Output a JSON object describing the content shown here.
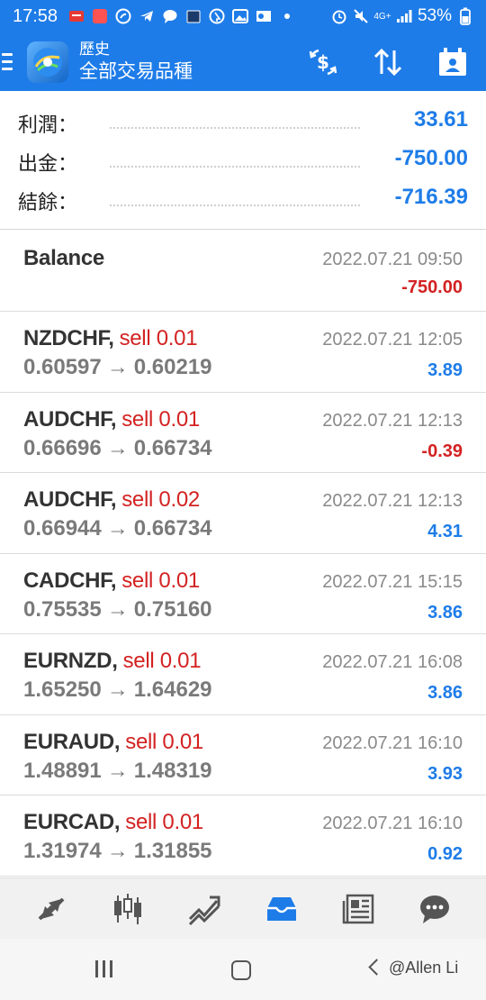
{
  "status_bar": {
    "time": "17:58",
    "network": "4G+",
    "battery": "53%"
  },
  "app_bar": {
    "subtitle": "歷史",
    "title": "全部交易品種",
    "icons": [
      "menu-icon",
      "app-logo-icon",
      "currency-filter-icon",
      "sort-icon",
      "calendar-icon"
    ]
  },
  "summary": {
    "rows": [
      {
        "label": "利潤：",
        "value": "33.61"
      },
      {
        "label": "出金：",
        "value": "-750.00"
      },
      {
        "label": "結餘：",
        "value": "-716.39"
      }
    ]
  },
  "balance_entry": {
    "label": "Balance",
    "datetime": "2022.07.21 09:50",
    "amount": "-750.00"
  },
  "trades": [
    {
      "symbol": "NZDCHF,",
      "side": "sell 0.01",
      "open": "0.60597",
      "close": "0.60219",
      "arrow": "→",
      "datetime": "2022.07.21 12:05",
      "profit": "3.89",
      "sign": "pos"
    },
    {
      "symbol": "AUDCHF,",
      "side": "sell 0.01",
      "open": "0.66696",
      "close": "0.66734",
      "arrow": "→",
      "datetime": "2022.07.21 12:13",
      "profit": "-0.39",
      "sign": "neg"
    },
    {
      "symbol": "AUDCHF,",
      "side": "sell 0.02",
      "open": "0.66944",
      "close": "0.66734",
      "arrow": "→",
      "datetime": "2022.07.21 12:13",
      "profit": "4.31",
      "sign": "pos"
    },
    {
      "symbol": "CADCHF,",
      "side": "sell 0.01",
      "open": "0.75535",
      "close": "0.75160",
      "arrow": "→",
      "datetime": "2022.07.21 15:15",
      "profit": "3.86",
      "sign": "pos"
    },
    {
      "symbol": "EURNZD,",
      "side": "sell 0.01",
      "open": "1.65250",
      "close": "1.64629",
      "arrow": "→",
      "datetime": "2022.07.21 16:08",
      "profit": "3.86",
      "sign": "pos"
    },
    {
      "symbol": "EURAUD,",
      "side": "sell 0.01",
      "open": "1.48891",
      "close": "1.48319",
      "arrow": "→",
      "datetime": "2022.07.21 16:10",
      "profit": "3.93",
      "sign": "pos"
    },
    {
      "symbol": "EURCAD,",
      "side": "sell 0.01",
      "open": "1.31974",
      "close": "1.31855",
      "arrow": "→",
      "datetime": "2022.07.21 16:10",
      "profit": "0.92",
      "sign": "pos"
    }
  ],
  "tab_bar": {
    "tabs": [
      "trade-icon",
      "chart-candles-icon",
      "trend-icon",
      "history-inbox-icon",
      "news-icon",
      "chat-icon"
    ],
    "active_index": 3
  },
  "watermark": "@Allen Li",
  "colors": {
    "accent": "#1e7ce8",
    "negative": "#d32222",
    "text_secondary": "#7a7a7a"
  }
}
